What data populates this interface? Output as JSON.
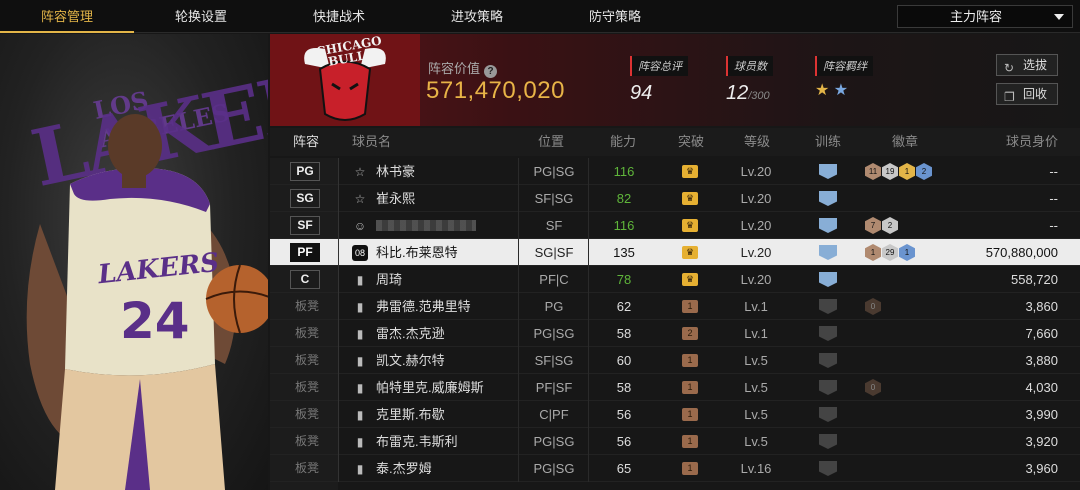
{
  "nav": {
    "tabs": [
      {
        "label": "阵容管理",
        "active": true
      },
      {
        "label": "轮换设置",
        "active": false
      },
      {
        "label": "快捷战术",
        "active": false
      },
      {
        "label": "进攻策略",
        "active": false
      },
      {
        "label": "防守策略",
        "active": false
      }
    ],
    "lineup_select": "主力阵容"
  },
  "hero": {
    "jersey_number": "24",
    "team_text": "LAKERS",
    "bg_text": "LAKERS",
    "bg_text2": "LOS ANGELES"
  },
  "header": {
    "team_logo_text": "CHICAGO BULLS",
    "value_label": "阵容价值",
    "value": "571,470,020",
    "rating_label": "阵容总评",
    "rating": "94",
    "count_label": "球员数",
    "count": "12",
    "count_max": "/300",
    "bond_label": "阵容羁绊",
    "btn_select": "选拔",
    "btn_recycle": "回收"
  },
  "columns": {
    "lineup": "阵容",
    "name": "球员名",
    "position": "位置",
    "ability": "能力",
    "breakthrough": "突破",
    "level": "等级",
    "training": "训练",
    "badges": "徽章",
    "value": "球员身价"
  },
  "colors": {
    "accent": "#e3b548",
    "green": "#5fb53a",
    "selected_row": "#ececec"
  },
  "players": [
    {
      "slot": "PG",
      "starter": true,
      "icon": "star-icon",
      "name": "林书豪",
      "pos": "PG|SG",
      "ability": "116",
      "ability_green": true,
      "bk_tier": "gold",
      "bk_num": "",
      "level": "Lv.20",
      "train": "blue",
      "badges": [
        {
          "t": "br",
          "n": "11"
        },
        {
          "t": "si",
          "n": "19"
        },
        {
          "t": "go",
          "n": "1"
        },
        {
          "t": "bl",
          "n": "2"
        }
      ],
      "value": "--"
    },
    {
      "slot": "SG",
      "starter": true,
      "icon": "star-icon",
      "name": "崔永熙",
      "pos": "SF|SG",
      "ability": "82",
      "ability_green": true,
      "bk_tier": "gold",
      "bk_num": "",
      "level": "Lv.20",
      "train": "blue",
      "badges": [],
      "value": "--"
    },
    {
      "slot": "SF",
      "starter": true,
      "icon": "person-icon",
      "name": "",
      "blurred": true,
      "pos": "SF",
      "ability": "116",
      "ability_green": true,
      "bk_tier": "gold",
      "bk_num": "",
      "level": "Lv.20",
      "train": "blue",
      "badges": [
        {
          "t": "br",
          "n": "7"
        },
        {
          "t": "si",
          "n": "2"
        }
      ],
      "value": "--"
    },
    {
      "slot": "PF",
      "starter": true,
      "selected": true,
      "icon": "08",
      "name": "科比.布莱恩特",
      "pos": "SG|SF",
      "ability": "135",
      "ability_green": false,
      "bk_tier": "gold",
      "bk_num": "",
      "level": "Lv.20",
      "train": "blue",
      "badges": [
        {
          "t": "br",
          "n": "1"
        },
        {
          "t": "si",
          "n": "29"
        },
        {
          "t": "bl",
          "n": "1"
        }
      ],
      "value": "570,880,000"
    },
    {
      "slot": "C",
      "starter": true,
      "icon": "stats-icon",
      "name": "周琦",
      "pos": "PF|C",
      "ability": "78",
      "ability_green": true,
      "bk_tier": "gold",
      "bk_num": "",
      "level": "Lv.20",
      "train": "blue",
      "badges": [],
      "value": "558,720"
    },
    {
      "slot": "板凳",
      "starter": false,
      "icon": "stats-icon",
      "name": "弗雷德.范弗里特",
      "pos": "PG",
      "ability": "62",
      "ability_green": false,
      "bk_tier": "bronze",
      "bk_num": "1",
      "level": "Lv.1",
      "train": "gray",
      "badges": [
        {
          "t": "dk",
          "n": "0"
        }
      ],
      "value": "3,860"
    },
    {
      "slot": "板凳",
      "starter": false,
      "icon": "stats-icon",
      "name": "雷杰.杰克逊",
      "pos": "PG|SG",
      "ability": "58",
      "ability_green": false,
      "bk_tier": "bronze",
      "bk_num": "2",
      "level": "Lv.1",
      "train": "gray",
      "badges": [],
      "value": "7,660"
    },
    {
      "slot": "板凳",
      "starter": false,
      "icon": "stats-icon",
      "name": "凯文.赫尔特",
      "pos": "SF|SG",
      "ability": "60",
      "ability_green": false,
      "bk_tier": "bronze",
      "bk_num": "1",
      "level": "Lv.5",
      "train": "gray",
      "badges": [],
      "value": "3,880"
    },
    {
      "slot": "板凳",
      "starter": false,
      "icon": "stats-icon",
      "name": "帕特里克.威廉姆斯",
      "pos": "PF|SF",
      "ability": "58",
      "ability_green": false,
      "bk_tier": "bronze",
      "bk_num": "1",
      "level": "Lv.5",
      "train": "gray",
      "badges": [
        {
          "t": "dk",
          "n": "0"
        }
      ],
      "value": "4,030"
    },
    {
      "slot": "板凳",
      "starter": false,
      "icon": "stats-icon",
      "name": "克里斯.布歇",
      "pos": "C|PF",
      "ability": "56",
      "ability_green": false,
      "bk_tier": "bronze",
      "bk_num": "1",
      "level": "Lv.5",
      "train": "gray",
      "badges": [],
      "value": "3,990"
    },
    {
      "slot": "板凳",
      "starter": false,
      "icon": "stats-icon",
      "name": "布雷克.韦斯利",
      "pos": "PG|SG",
      "ability": "56",
      "ability_green": false,
      "bk_tier": "bronze",
      "bk_num": "1",
      "level": "Lv.5",
      "train": "gray",
      "badges": [],
      "value": "3,920"
    },
    {
      "slot": "板凳",
      "starter": false,
      "icon": "stats-icon",
      "name": "泰.杰罗姆",
      "pos": "PG|SG",
      "ability": "65",
      "ability_green": false,
      "bk_tier": "bronze",
      "bk_num": "1",
      "level": "Lv.16",
      "train": "gray",
      "badges": [],
      "value": "3,960"
    }
  ]
}
